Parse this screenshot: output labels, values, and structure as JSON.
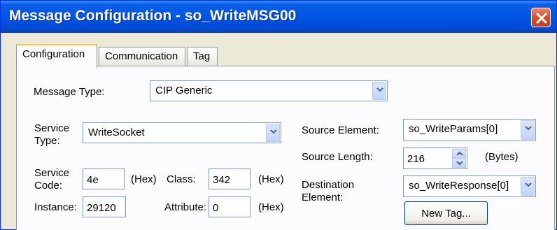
{
  "window": {
    "title": "Message Configuration - so_WriteMSG00"
  },
  "tabs": [
    {
      "label": "Configuration"
    },
    {
      "label": "Communication"
    },
    {
      "label": "Tag"
    }
  ],
  "form": {
    "message_type_label": "Message Type:",
    "message_type_value": "CIP Generic",
    "service_type_label_1": "Service",
    "service_type_label_2": "Type:",
    "service_type_value": "WriteSocket",
    "service_code_label_1": "Service",
    "service_code_label_2": "Code:",
    "service_code_value": "4e",
    "hex_label": "(Hex)",
    "class_label": "Class:",
    "class_value": "342",
    "instance_label": "Instance:",
    "instance_value": "29120",
    "attribute_label": "Attribute:",
    "attribute_value": "0",
    "source_element_label": "Source Element:",
    "source_element_value": "so_WriteParams[0]",
    "source_length_label": "Source Length:",
    "source_length_value": "216",
    "bytes_label": "(Bytes)",
    "destination_label_1": "Destination",
    "destination_label_2": "Element:",
    "destination_value": "so_WriteResponse[0]",
    "new_tag_label": "New Tag..."
  },
  "icons": {
    "close": "close-icon",
    "dropdown": "chevron-down-icon",
    "spin_up": "chevron-up-icon",
    "spin_down": "chevron-down-icon"
  },
  "colors": {
    "titlebar": "#0055e5",
    "close_button": "#d5502c",
    "active_tab_accent": "#f5c65a",
    "dialog_bg": "#ece9d8"
  }
}
